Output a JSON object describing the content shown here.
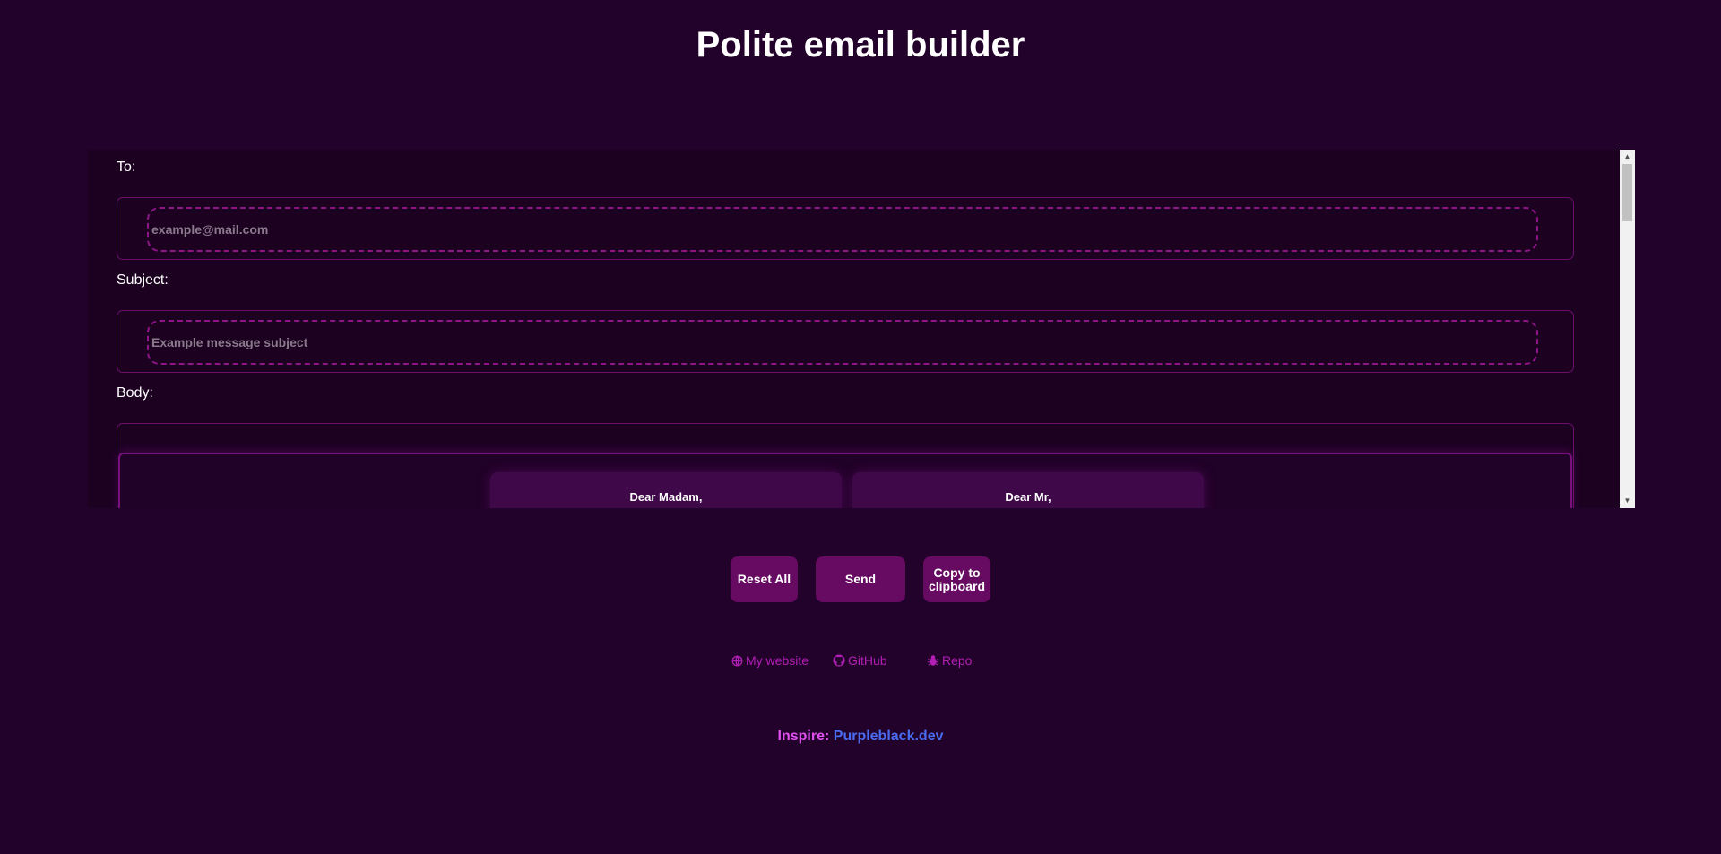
{
  "header": {
    "title": "Polite email builder"
  },
  "form": {
    "to": {
      "label": "To:",
      "placeholder": "example@mail.com",
      "value": ""
    },
    "subject": {
      "label": "Subject:",
      "placeholder": "Example message subject",
      "value": ""
    },
    "body": {
      "label": "Body:",
      "greetings": [
        "Dear Madam,",
        "Dear Mr,"
      ]
    }
  },
  "actions": {
    "reset_label": "Reset All",
    "send_label": "Send",
    "copy_label": "Copy to clipboard"
  },
  "footer": {
    "links": [
      {
        "label": "My website",
        "icon": "globe-icon"
      },
      {
        "label": "GitHub",
        "icon": "github-icon"
      },
      {
        "label": "Repo",
        "icon": "bug-icon"
      }
    ],
    "inspire_label": "Inspire:",
    "inspire_link": "Purpleblack.dev"
  },
  "colors": {
    "background": "#22012a",
    "panel": "#1c0121",
    "accent": "#660a62",
    "border": "#6c0f6c",
    "link": "#b21fb5",
    "inspire_label": "#e24ff0",
    "inspire_link": "#4a6cf0"
  }
}
